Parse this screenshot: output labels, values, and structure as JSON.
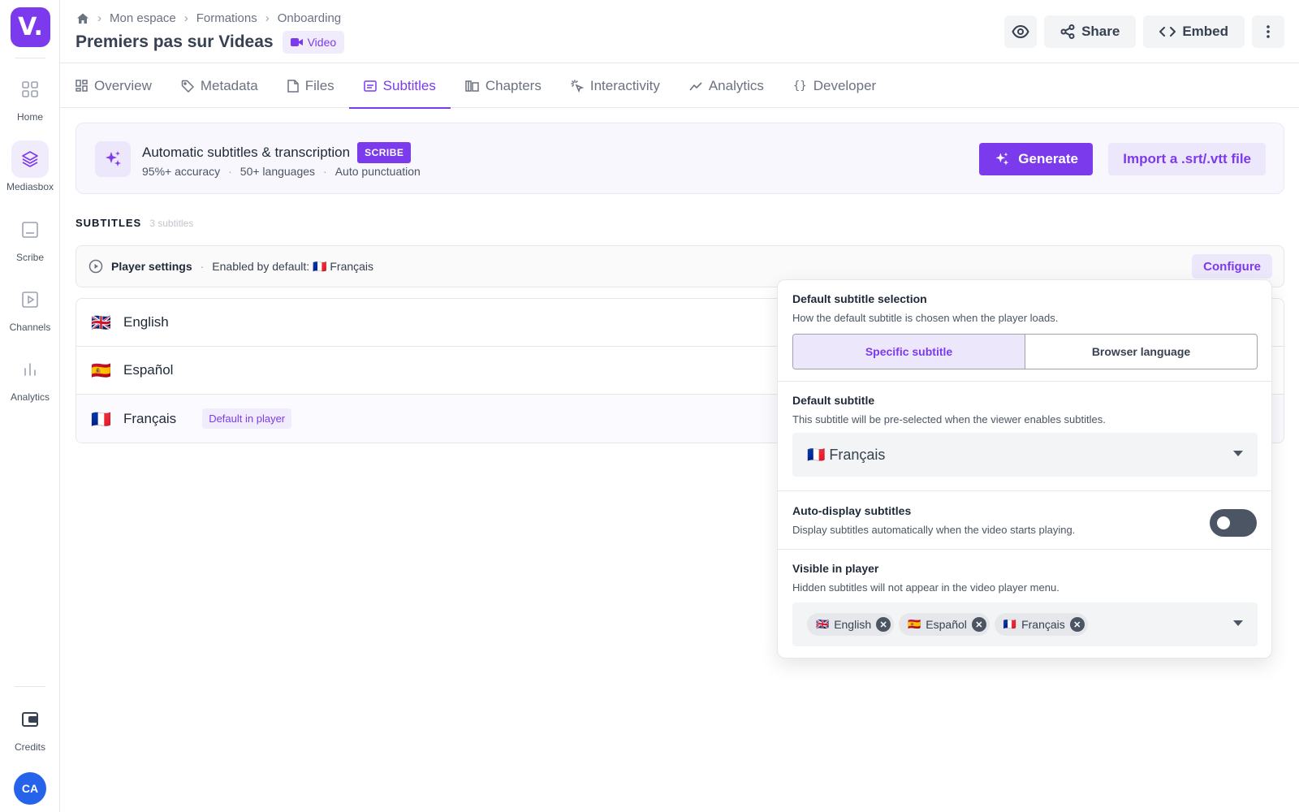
{
  "sidebar": {
    "logo": "V.",
    "items": [
      {
        "label": "Home",
        "icon": "grid-icon"
      },
      {
        "label": "Mediasbox",
        "icon": "layers-icon"
      },
      {
        "label": "Scribe",
        "icon": "subtitles-icon"
      },
      {
        "label": "Channels",
        "icon": "play-icon"
      },
      {
        "label": "Analytics",
        "icon": "bar-chart-icon"
      }
    ],
    "credits_label": "Credits",
    "avatar_initials": "CA"
  },
  "header": {
    "breadcrumb": [
      "Mon espace",
      "Formations",
      "Onboarding"
    ],
    "title": "Premiers pas sur Videas",
    "type_badge": "Video",
    "share_label": "Share",
    "embed_label": "Embed"
  },
  "tabs": [
    {
      "label": "Overview",
      "icon": "dashboard-icon"
    },
    {
      "label": "Metadata",
      "icon": "tag-icon"
    },
    {
      "label": "Files",
      "icon": "file-icon"
    },
    {
      "label": "Subtitles",
      "icon": "subtitles-icon"
    },
    {
      "label": "Chapters",
      "icon": "book-icon"
    },
    {
      "label": "Interactivity",
      "icon": "pointer-icon"
    },
    {
      "label": "Analytics",
      "icon": "trend-icon"
    },
    {
      "label": "Developer",
      "icon": "braces-icon"
    }
  ],
  "promo": {
    "title": "Automatic subtitles & transcription",
    "tag": "SCRIBE",
    "features": [
      "95%+ accuracy",
      "50+ languages",
      "Auto punctuation"
    ],
    "generate_label": "Generate",
    "import_label": "Import a .srt/.vtt file"
  },
  "subtitles": {
    "section_title": "SUBTITLES",
    "count": "3 subtitles",
    "player_settings_label": "Player settings",
    "enabled_default": "Enabled by default: 🇫🇷 Français",
    "configure_label": "Configure",
    "default_badge": "Default in player",
    "items": [
      {
        "flag": "🇬🇧",
        "name": "English"
      },
      {
        "flag": "🇪🇸",
        "name": "Español"
      },
      {
        "flag": "🇫🇷",
        "name": "Français"
      }
    ]
  },
  "popover": {
    "selection_title": "Default subtitle selection",
    "selection_desc": "How the default subtitle is chosen when the player loads.",
    "option_specific": "Specific subtitle",
    "option_browser": "Browser language",
    "default_title": "Default subtitle",
    "default_desc": "This subtitle will be pre-selected when the viewer enables subtitles.",
    "default_value": "🇫🇷 Français",
    "auto_title": "Auto-display subtitles",
    "auto_desc": "Display subtitles automatically when the video starts playing.",
    "auto_enabled": false,
    "visible_title": "Visible in player",
    "visible_desc": "Hidden subtitles will not appear in the video player menu.",
    "visible_chips": [
      {
        "flag": "🇬🇧",
        "name": "English"
      },
      {
        "flag": "🇪🇸",
        "name": "Español"
      },
      {
        "flag": "🇫🇷",
        "name": "Français"
      }
    ]
  },
  "colors": {
    "accent": "#7c3aed",
    "accent_light": "#ede7fb",
    "avatar": "#2563eb"
  }
}
